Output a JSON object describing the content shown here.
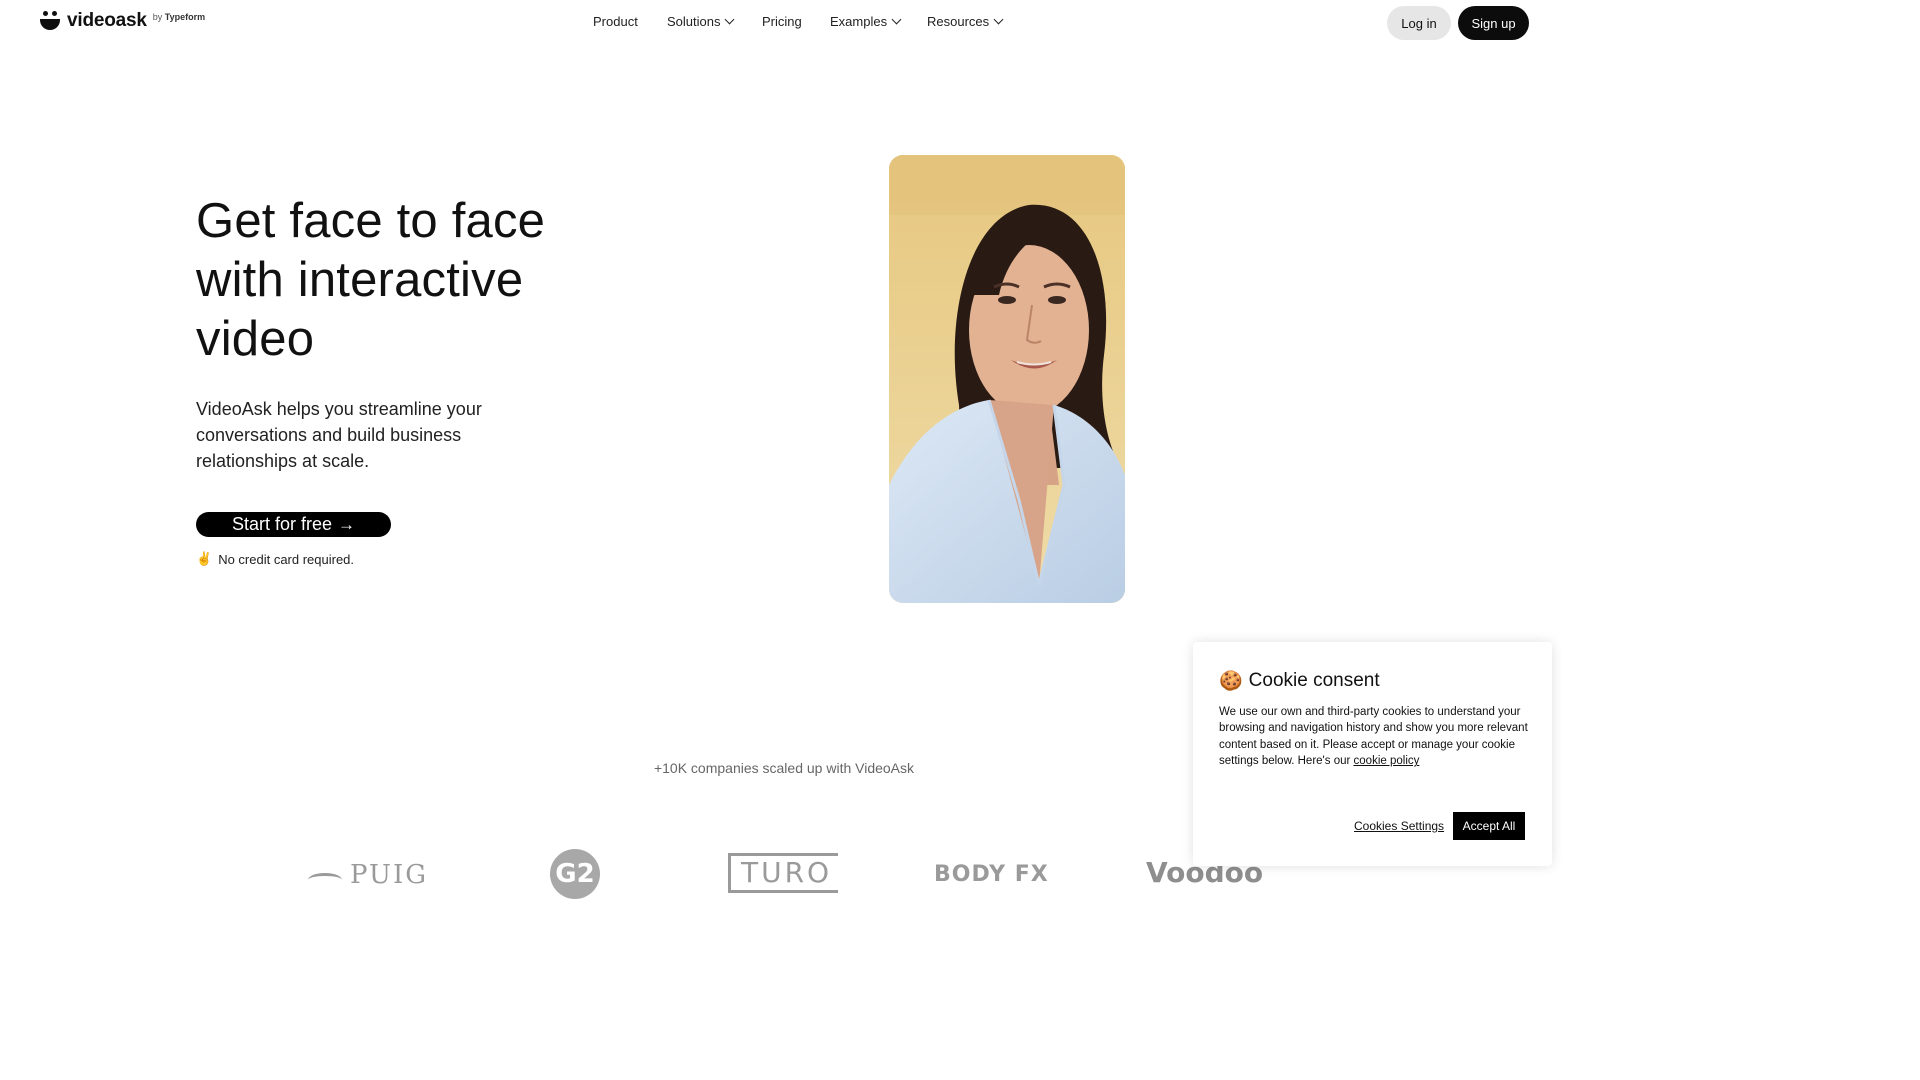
{
  "brand": {
    "name": "videoask",
    "by_prefix": "by",
    "by_name": "Typeform"
  },
  "nav": {
    "items": [
      {
        "label": "Product",
        "has_dropdown": false
      },
      {
        "label": "Solutions",
        "has_dropdown": true
      },
      {
        "label": "Pricing",
        "has_dropdown": false
      },
      {
        "label": "Examples",
        "has_dropdown": true
      },
      {
        "label": "Resources",
        "has_dropdown": true
      }
    ],
    "login_label": "Log in",
    "signup_label": "Sign up"
  },
  "hero": {
    "title": "Get face to face with interactive video",
    "subtitle": "VideoAsk helps you streamline your conversations and build business relationships at scale.",
    "cta_label": "Start for free",
    "cta_arrow": "→",
    "note_emoji": "✌️",
    "note": "No credit card required."
  },
  "companies": {
    "label": "+10K companies scaled up with VideoAsk",
    "logos": [
      "PUIG",
      "G2",
      "TURO",
      "BODY FX",
      "Voodoo"
    ]
  },
  "cookie": {
    "emoji": "🍪",
    "title": "Cookie consent",
    "text": "We use our own and third-party cookies to understand your browsing and navigation history and show you more relevant content based on it. Please accept or manage your cookie settings below. Here's our",
    "link": "cookie policy",
    "settings_label": "Cookies Settings",
    "accept_label": "Accept All"
  },
  "colors": {
    "primary": "#000000",
    "login_bg": "#e6e6e6",
    "video_bg": "#e9cf8e",
    "muted_text": "#666666"
  }
}
